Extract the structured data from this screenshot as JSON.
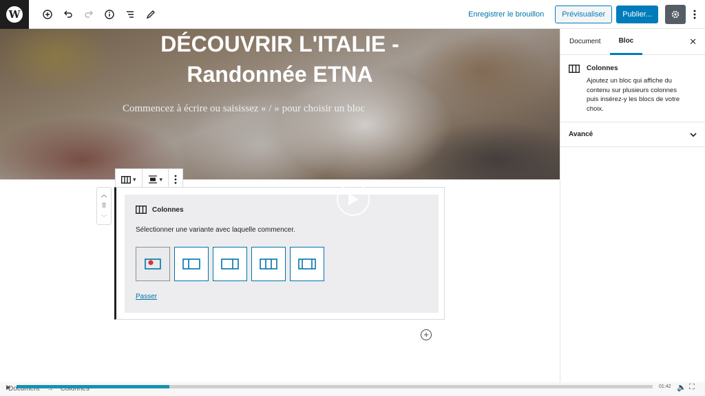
{
  "topbar": {
    "logo": "W",
    "tools": [
      {
        "icon": "plus-circle-icon",
        "glyph": "⊕"
      },
      {
        "icon": "undo-icon",
        "glyph": "↶"
      },
      {
        "icon": "redo-icon",
        "glyph": "↷"
      },
      {
        "icon": "info-icon",
        "glyph": "ⓘ"
      },
      {
        "icon": "list-icon",
        "glyph": "☰"
      },
      {
        "icon": "pencil-icon",
        "glyph": "✎"
      }
    ],
    "save_draft": "Enregistrer le brouillon",
    "preview": "Prévisualiser",
    "publish": "Publier...",
    "settings_glyph": "⚙",
    "more_glyph": "⋮",
    "accent": "#007cba"
  },
  "cover": {
    "title_line1": "DÉCOUVRIR L'ITALIE -",
    "title_line2": "Randonnée ETNA",
    "placeholder": "Commencez à écrire ou saisissez « / » pour choisir un bloc"
  },
  "block": {
    "name": "Colonnes",
    "description": "Sélectionner une variante avec laquelle commencer.",
    "skip": "Passer",
    "variants": [
      "100",
      "50-50",
      "33-66",
      "33-33-33",
      "25-50-25"
    ]
  },
  "sidebar": {
    "tabs": [
      "Document",
      "Bloc"
    ],
    "active_tab": "Bloc",
    "close_glyph": "✕",
    "block_title": "Colonnes",
    "block_description": "Ajoutez un bloc qui affiche du contenu sur plusieurs colonnes puis insérez-y les blocs de votre choix.",
    "advanced": "Avancé"
  },
  "footer": {
    "breadcrumb": [
      "Document",
      "→",
      "Colonnes"
    ],
    "time": "01:42",
    "progress": 0.24
  }
}
